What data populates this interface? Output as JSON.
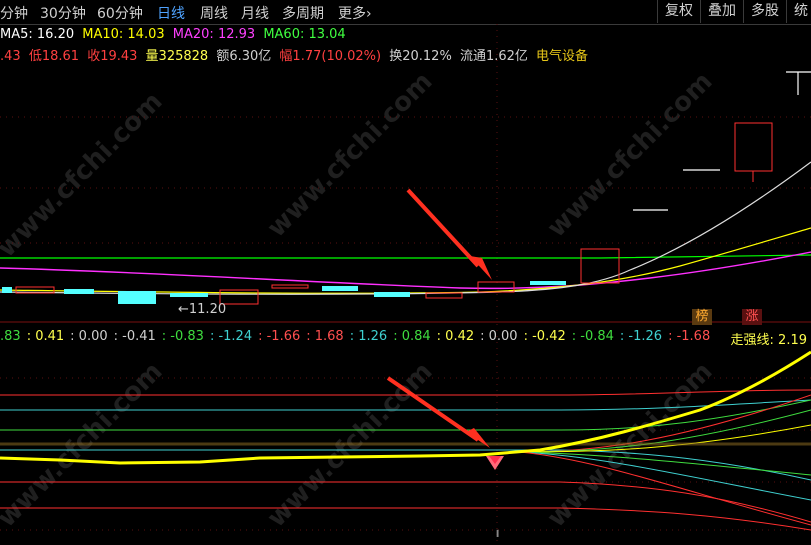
{
  "toolbar": {
    "periods": [
      "分钟",
      "30分钟",
      "60分钟",
      "日线",
      "周线",
      "月线",
      "多周期",
      "更多"
    ],
    "active_period": "日线",
    "more_arrow": "›",
    "buttons": [
      "复权",
      "叠加",
      "多股",
      "统"
    ]
  },
  "ma_line": {
    "ma5": "MA5: 16.20",
    "ma10": "MA10: 14.03",
    "ma20": "MA20: 12.93",
    "ma60": "MA60: 13.04"
  },
  "quote_line": {
    "open": ".43",
    "low": "低18.61",
    "close": "收19.43",
    "volume": "量325828",
    "amount": "额6.30亿",
    "change": "幅1.77(10.02%)",
    "turnover": "换20.12%",
    "float": "流通1.62亿",
    "sector": "电气设备"
  },
  "chart": {
    "low_marker": "←11.20",
    "badge_bang": "榜",
    "badge_zhang": "涨",
    "indicator_values": [
      ".83",
      "0.41",
      "0.00",
      "-0.41",
      "-0.83",
      "-1.24",
      "-1.66",
      "1.68",
      "1.26",
      "0.84",
      "0.42",
      "0.00",
      "-0.42",
      "-0.84",
      "-1.26",
      "-1.68"
    ],
    "indicator_colors": [
      "#3fdc3f",
      "#ffff4f",
      "#d0d0d0",
      "#d0d0d0",
      "#3fdc3f",
      "#3fd0d0",
      "#ff4f4f",
      "#ff4f4f",
      "#3fd0d0",
      "#3fdc3f",
      "#ffff4f",
      "#d0d0d0",
      "#ffff4f",
      "#3fdc3f",
      "#3fd0d0",
      "#ff4f4f"
    ],
    "strength_label": "走强线: 2.19"
  },
  "watermark": "www.cfchi.com",
  "colors": {
    "ma5": "#ffffff",
    "ma10": "#ffff00",
    "ma20": "#ff00ff",
    "ma60": "#00ff00",
    "up": "#ff3030",
    "down": "#54ffff"
  }
}
